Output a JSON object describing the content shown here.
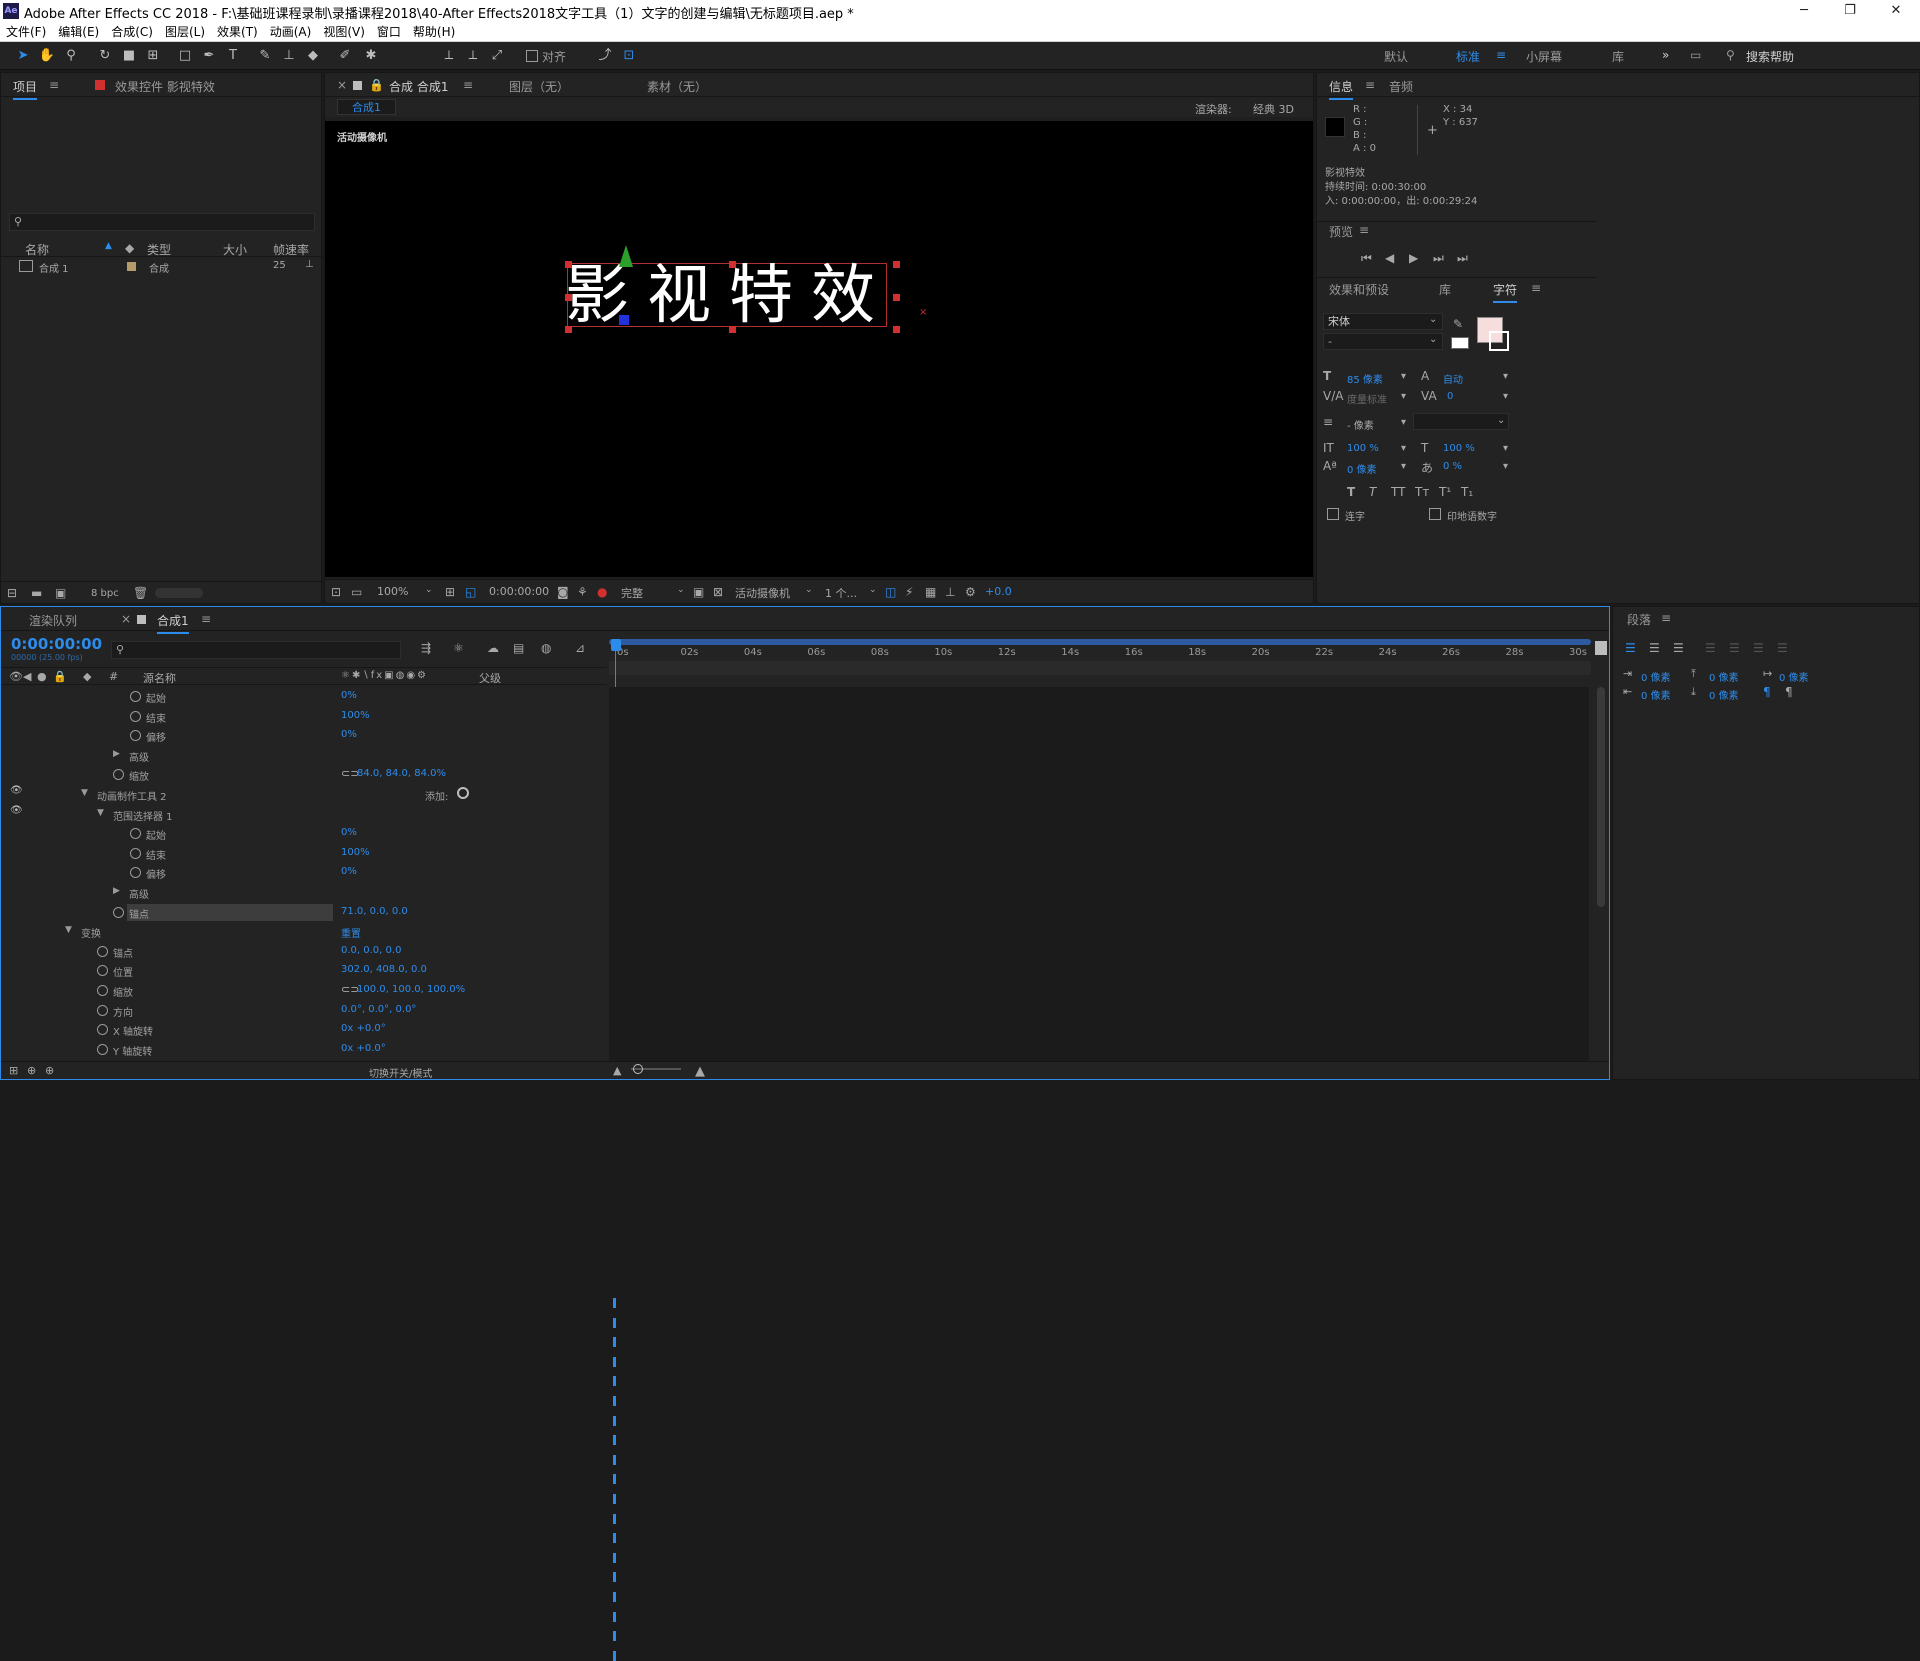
{
  "title": "Adobe After Effects CC 2018 - F:\\基础班课程录制\\录播课程2018\\40-After Effects2018文字工具（1）文字的创建与编辑\\无标题项目.aep *",
  "app_icon": "Ae",
  "menu": [
    "文件(F)",
    "编辑(E)",
    "合成(C)",
    "图层(L)",
    "效果(T)",
    "动画(A)",
    "视图(V)",
    "窗口",
    "帮助(H)"
  ],
  "toolbar": {
    "align_label": "对齐",
    "workspaces": [
      "默认",
      "标准",
      "小屏幕",
      "库"
    ],
    "active_ws": "标准",
    "search_placeholder": "搜索帮助",
    "overflow": "»"
  },
  "project": {
    "tab_project": "项目",
    "tab_effects": "效果控件 影视特效",
    "columns": [
      "名称",
      "类型",
      "大小",
      "帧速率"
    ],
    "item": {
      "name": "合成 1",
      "type": "合成",
      "fps": "25"
    },
    "bpc": "8 bpc"
  },
  "composition": {
    "tab_comp": "合成 合成1",
    "tab_layer": "图层（无）",
    "tab_footage": "素材（无）",
    "breadcrumb": "合成1",
    "renderer_label": "渲染器:",
    "renderer": "经典 3D",
    "camera_label": "活动摄像机",
    "text": "影视特效",
    "zoom": "100%",
    "time": "0:00:00:00",
    "quality": "完整",
    "view": "活动摄像机",
    "views": "1 个...",
    "exposure": "+0.0"
  },
  "info": {
    "tab_info": "信息",
    "tab_audio": "音频",
    "r": "R :",
    "g": "G :",
    "b": "B :",
    "a": "A : 0",
    "x": "X : 34",
    "y": "Y : 637",
    "layer": "影视特效",
    "duration": "持续时间: 0:00:30:00",
    "inout": "入: 0:00:00:00，出: 0:00:29:24"
  },
  "preview": {
    "title": "预览"
  },
  "character": {
    "tab_effects": "效果和预设",
    "tab_lib": "库",
    "tab_char": "字符",
    "font": "宋体",
    "style": "-",
    "size": "85 像素",
    "leading": "自动",
    "kerning": "度量标准",
    "tracking": "0",
    "stroke": "- 像素",
    "vscale": "100 %",
    "hscale": "100 %",
    "baseline": "0 像素",
    "tsume": "0 %",
    "ligature": "连字",
    "hindi": "印地语数字"
  },
  "timeline": {
    "tab_render": "渲染队列",
    "tab_comp": "合成1",
    "timecode": "0:00:00:00",
    "fps": "00000 (25.00 fps)",
    "col_name": "源名称",
    "col_parent": "父级",
    "ruler": [
      "0s",
      "02s",
      "04s",
      "06s",
      "08s",
      "10s",
      "12s",
      "14s",
      "16s",
      "18s",
      "20s",
      "22s",
      "24s",
      "26s",
      "28s",
      "30s"
    ],
    "toggle": "切换开关/模式",
    "rows": [
      {
        "indent": 145,
        "label": "起始",
        "value": "0%",
        "sw": true
      },
      {
        "indent": 145,
        "label": "结束",
        "value": "100%",
        "sw": true
      },
      {
        "indent": 145,
        "label": "偏移",
        "value": "0%",
        "sw": true
      },
      {
        "indent": 128,
        "label": "高级",
        "value": "",
        "tri": "▶"
      },
      {
        "indent": 128,
        "label": "缩放",
        "value": "84.0, 84.0, 84.0%",
        "sw": true,
        "link": true
      },
      {
        "indent": 96,
        "label": "动画制作工具 2",
        "value": "",
        "tri": "▼",
        "eye": true,
        "add": "添加:"
      },
      {
        "indent": 112,
        "label": "范围选择器 1",
        "value": "",
        "tri": "▼",
        "eye": true
      },
      {
        "indent": 145,
        "label": "起始",
        "value": "0%",
        "sw": true
      },
      {
        "indent": 145,
        "label": "结束",
        "value": "100%",
        "sw": true
      },
      {
        "indent": 145,
        "label": "偏移",
        "value": "0%",
        "sw": true
      },
      {
        "indent": 128,
        "label": "高级",
        "value": "",
        "tri": "▶"
      },
      {
        "indent": 128,
        "label": "锚点",
        "value": "71.0, 0.0, 0.0",
        "sw": true,
        "hl": true
      },
      {
        "indent": 80,
        "label": "变换",
        "value": "重置",
        "tri": "▼"
      },
      {
        "indent": 112,
        "label": "锚点",
        "value": "0.0, 0.0, 0.0",
        "sw": true
      },
      {
        "indent": 112,
        "label": "位置",
        "value": "302.0, 408.0, 0.0",
        "sw": true
      },
      {
        "indent": 112,
        "label": "缩放",
        "value": "100.0, 100.0, 100.0%",
        "sw": true,
        "link": true
      },
      {
        "indent": 112,
        "label": "方向",
        "value": "0.0°, 0.0°, 0.0°",
        "sw": true
      },
      {
        "indent": 112,
        "label": "X 轴旋转",
        "value": "0x +0.0°",
        "sw": true
      },
      {
        "indent": 112,
        "label": "Y 轴旋转",
        "value": "0x +0.0°",
        "sw": true
      }
    ]
  },
  "paragraph": {
    "title": "段落",
    "indent_vals": [
      "0 像素",
      "0 像素",
      "0 像素",
      "0 像素",
      "0 像素"
    ]
  }
}
